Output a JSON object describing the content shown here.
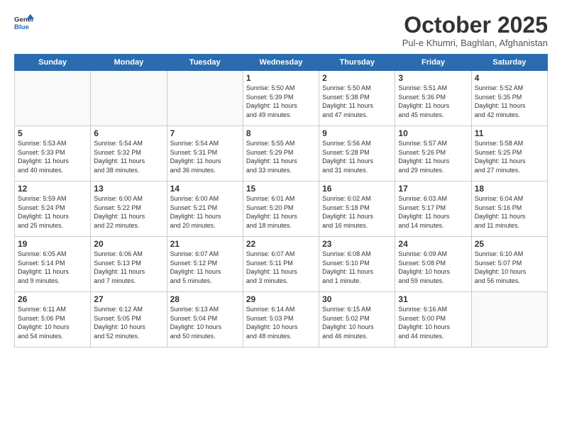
{
  "logo": {
    "text_general": "General",
    "text_blue": "Blue"
  },
  "header": {
    "month_title": "October 2025",
    "subtitle": "Pul-e Khumri, Baghlan, Afghanistan"
  },
  "days_of_week": [
    "Sunday",
    "Monday",
    "Tuesday",
    "Wednesday",
    "Thursday",
    "Friday",
    "Saturday"
  ],
  "weeks": [
    [
      {
        "day": "",
        "info": ""
      },
      {
        "day": "",
        "info": ""
      },
      {
        "day": "",
        "info": ""
      },
      {
        "day": "1",
        "info": "Sunrise: 5:50 AM\nSunset: 5:39 PM\nDaylight: 11 hours\nand 49 minutes."
      },
      {
        "day": "2",
        "info": "Sunrise: 5:50 AM\nSunset: 5:38 PM\nDaylight: 11 hours\nand 47 minutes."
      },
      {
        "day": "3",
        "info": "Sunrise: 5:51 AM\nSunset: 5:36 PM\nDaylight: 11 hours\nand 45 minutes."
      },
      {
        "day": "4",
        "info": "Sunrise: 5:52 AM\nSunset: 5:35 PM\nDaylight: 11 hours\nand 42 minutes."
      }
    ],
    [
      {
        "day": "5",
        "info": "Sunrise: 5:53 AM\nSunset: 5:33 PM\nDaylight: 11 hours\nand 40 minutes."
      },
      {
        "day": "6",
        "info": "Sunrise: 5:54 AM\nSunset: 5:32 PM\nDaylight: 11 hours\nand 38 minutes."
      },
      {
        "day": "7",
        "info": "Sunrise: 5:54 AM\nSunset: 5:31 PM\nDaylight: 11 hours\nand 36 minutes."
      },
      {
        "day": "8",
        "info": "Sunrise: 5:55 AM\nSunset: 5:29 PM\nDaylight: 11 hours\nand 33 minutes."
      },
      {
        "day": "9",
        "info": "Sunrise: 5:56 AM\nSunset: 5:28 PM\nDaylight: 11 hours\nand 31 minutes."
      },
      {
        "day": "10",
        "info": "Sunrise: 5:57 AM\nSunset: 5:26 PM\nDaylight: 11 hours\nand 29 minutes."
      },
      {
        "day": "11",
        "info": "Sunrise: 5:58 AM\nSunset: 5:25 PM\nDaylight: 11 hours\nand 27 minutes."
      }
    ],
    [
      {
        "day": "12",
        "info": "Sunrise: 5:59 AM\nSunset: 5:24 PM\nDaylight: 11 hours\nand 25 minutes."
      },
      {
        "day": "13",
        "info": "Sunrise: 6:00 AM\nSunset: 5:22 PM\nDaylight: 11 hours\nand 22 minutes."
      },
      {
        "day": "14",
        "info": "Sunrise: 6:00 AM\nSunset: 5:21 PM\nDaylight: 11 hours\nand 20 minutes."
      },
      {
        "day": "15",
        "info": "Sunrise: 6:01 AM\nSunset: 5:20 PM\nDaylight: 11 hours\nand 18 minutes."
      },
      {
        "day": "16",
        "info": "Sunrise: 6:02 AM\nSunset: 5:18 PM\nDaylight: 11 hours\nand 16 minutes."
      },
      {
        "day": "17",
        "info": "Sunrise: 6:03 AM\nSunset: 5:17 PM\nDaylight: 11 hours\nand 14 minutes."
      },
      {
        "day": "18",
        "info": "Sunrise: 6:04 AM\nSunset: 5:16 PM\nDaylight: 11 hours\nand 11 minutes."
      }
    ],
    [
      {
        "day": "19",
        "info": "Sunrise: 6:05 AM\nSunset: 5:14 PM\nDaylight: 11 hours\nand 9 minutes."
      },
      {
        "day": "20",
        "info": "Sunrise: 6:06 AM\nSunset: 5:13 PM\nDaylight: 11 hours\nand 7 minutes."
      },
      {
        "day": "21",
        "info": "Sunrise: 6:07 AM\nSunset: 5:12 PM\nDaylight: 11 hours\nand 5 minutes."
      },
      {
        "day": "22",
        "info": "Sunrise: 6:07 AM\nSunset: 5:11 PM\nDaylight: 11 hours\nand 3 minutes."
      },
      {
        "day": "23",
        "info": "Sunrise: 6:08 AM\nSunset: 5:10 PM\nDaylight: 11 hours\nand 1 minute."
      },
      {
        "day": "24",
        "info": "Sunrise: 6:09 AM\nSunset: 5:08 PM\nDaylight: 10 hours\nand 59 minutes."
      },
      {
        "day": "25",
        "info": "Sunrise: 6:10 AM\nSunset: 5:07 PM\nDaylight: 10 hours\nand 56 minutes."
      }
    ],
    [
      {
        "day": "26",
        "info": "Sunrise: 6:11 AM\nSunset: 5:06 PM\nDaylight: 10 hours\nand 54 minutes."
      },
      {
        "day": "27",
        "info": "Sunrise: 6:12 AM\nSunset: 5:05 PM\nDaylight: 10 hours\nand 52 minutes."
      },
      {
        "day": "28",
        "info": "Sunrise: 6:13 AM\nSunset: 5:04 PM\nDaylight: 10 hours\nand 50 minutes."
      },
      {
        "day": "29",
        "info": "Sunrise: 6:14 AM\nSunset: 5:03 PM\nDaylight: 10 hours\nand 48 minutes."
      },
      {
        "day": "30",
        "info": "Sunrise: 6:15 AM\nSunset: 5:02 PM\nDaylight: 10 hours\nand 46 minutes."
      },
      {
        "day": "31",
        "info": "Sunrise: 6:16 AM\nSunset: 5:00 PM\nDaylight: 10 hours\nand 44 minutes."
      },
      {
        "day": "",
        "info": ""
      }
    ]
  ]
}
